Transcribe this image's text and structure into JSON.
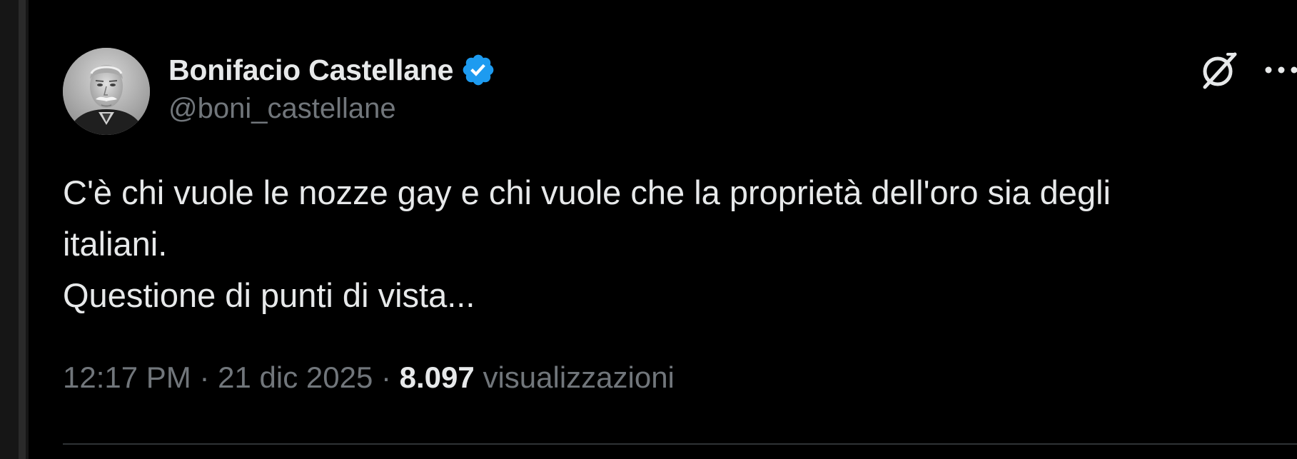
{
  "author": {
    "display_name": "Bonifacio Castellane",
    "handle": "@boni_castellane",
    "verified": true,
    "avatar_icon": "portrait-photo",
    "verified_icon": "verified-badge-icon"
  },
  "tweet": {
    "text_lines": [
      "C'è chi vuole le nozze gay e chi vuole che la proprietà dell'oro sia degli",
      "italiani.",
      "Questione di punti di vista..."
    ]
  },
  "meta": {
    "time": "12:17 PM",
    "separator": "·",
    "date": "21 dic 2025",
    "views_count": "8.097",
    "views_label": "visualizzazioni"
  },
  "actions": {
    "grok_icon": "grok-icon",
    "more_icon": "more-icon"
  },
  "colors": {
    "background": "#000000",
    "primary_text": "#e7e9ea",
    "secondary_text": "#71767b",
    "verified_blue": "#1d9bf0",
    "divider": "#2f3336"
  }
}
